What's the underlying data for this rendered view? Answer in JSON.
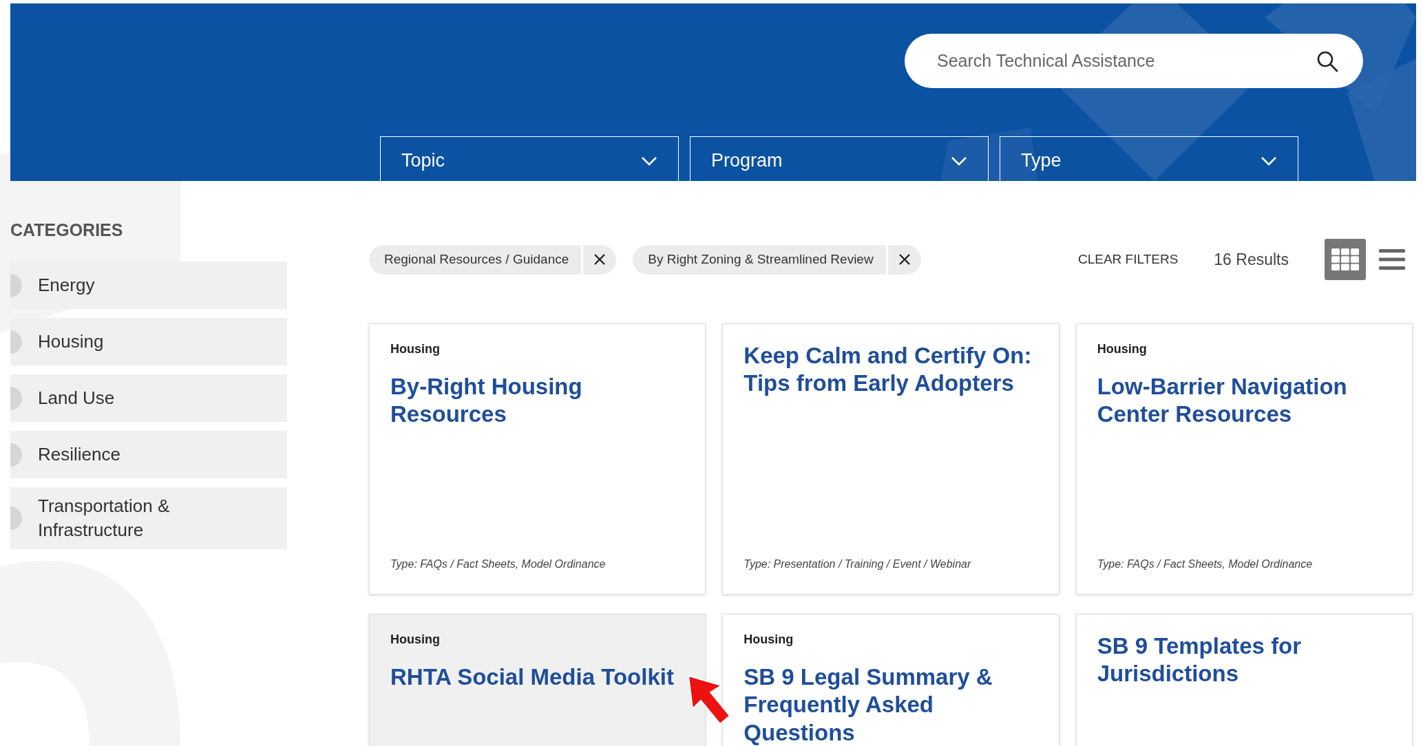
{
  "search": {
    "placeholder": "Search Technical Assistance"
  },
  "dropdowns": [
    {
      "label": "Topic"
    },
    {
      "label": "Program"
    },
    {
      "label": "Type"
    }
  ],
  "sidebar": {
    "heading": "CATEGORIES",
    "items": [
      {
        "label": "Energy"
      },
      {
        "label": "Housing"
      },
      {
        "label": "Land Use"
      },
      {
        "label": "Resilience"
      },
      {
        "label": "Transportation & Infrastructure"
      }
    ]
  },
  "filters": [
    {
      "label": "Regional Resources / Guidance"
    },
    {
      "label": "By Right Zoning & Streamlined Review"
    }
  ],
  "clear_filters": "CLEAR FILTERS",
  "results": "16 Results",
  "views": [
    {
      "kind": "grid",
      "selected": true
    },
    {
      "kind": "list",
      "selected": false
    }
  ],
  "cards": [
    {
      "category": "Housing",
      "title": "By-Right Housing Resources",
      "type": "Type: FAQs / Fact Sheets, Model Ordinance",
      "highlighted": false
    },
    {
      "title": "Keep Calm and Certify On: Tips from Early Adopters",
      "type": "Type: Presentation / Training / Event / Webinar",
      "highlighted": false
    },
    {
      "category": "Housing",
      "title": "Low-Barrier Navigation Center Resources",
      "type": "Type: FAQs / Fact Sheets, Model Ordinance",
      "highlighted": false
    },
    {
      "category": "Housing",
      "title": "RHTA Social Media Toolkit",
      "highlighted": true
    },
    {
      "category": "Housing",
      "title": "SB 9 Legal Summary & Frequently Asked Questions",
      "highlighted": false
    },
    {
      "title": "SB 9 Templates for Jurisdictions",
      "highlighted": false
    }
  ]
}
